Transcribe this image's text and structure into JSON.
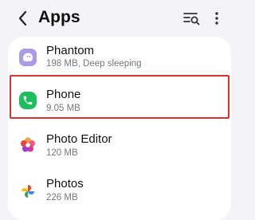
{
  "header": {
    "title": "Apps"
  },
  "apps": [
    {
      "name": "Phantom",
      "detail": "198 MB, Deep sleeping",
      "icon": "phantom-ghost-icon",
      "color": "#a99be6"
    },
    {
      "name": "Phone",
      "detail": "9.05 MB",
      "icon": "phone-icon",
      "color": "#1dbf5c"
    },
    {
      "name": "Photo Editor",
      "detail": "120 MB",
      "icon": "photo-editor-flower-icon",
      "color": "#e63a8a"
    },
    {
      "name": "Photos",
      "detail": "226 MB",
      "icon": "google-photos-pinwheel-icon",
      "color": "#4285f4"
    }
  ],
  "colors": {
    "background": "#f4f4f6",
    "card": "#ffffff",
    "highlight_border": "#d93030"
  }
}
